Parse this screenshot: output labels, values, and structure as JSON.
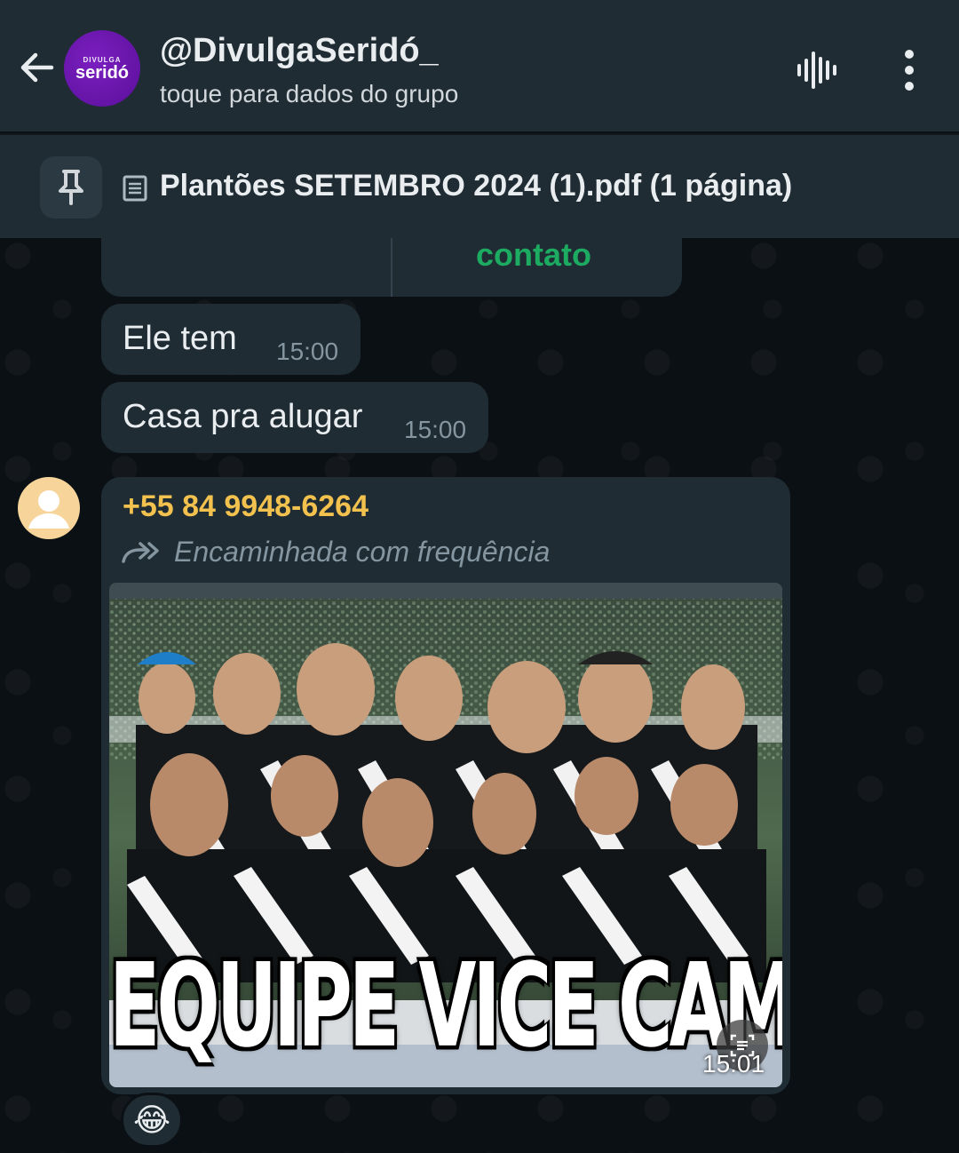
{
  "header": {
    "title": "@DivulgaSeridó_",
    "subtitle": "toque para dados do grupo",
    "avatar_small": "DIVULGA",
    "avatar_big": "seridó"
  },
  "pinned": {
    "text": "Plantões SETEMBRO 2024 (1).pdf (1 página)"
  },
  "messages": {
    "contact_card_action": "contato",
    "msg1": {
      "text": "Ele tem",
      "time": "15:00"
    },
    "msg2": {
      "text": "Casa pra alugar",
      "time": "15:00"
    },
    "image_msg": {
      "sender": "+55 84 9948-6264",
      "forwarded": "Encaminhada com frequência",
      "image_caption_text": "EQUIPE VICE CAMPEÃ",
      "time": "15:01",
      "reaction": "😂"
    }
  },
  "colors": {
    "header_bg": "#1f2c34",
    "bubble_bg": "#1f2c34",
    "accent_green": "#1daa61",
    "sender_name": "#f2c14e",
    "wallpaper": "#0b1014"
  }
}
